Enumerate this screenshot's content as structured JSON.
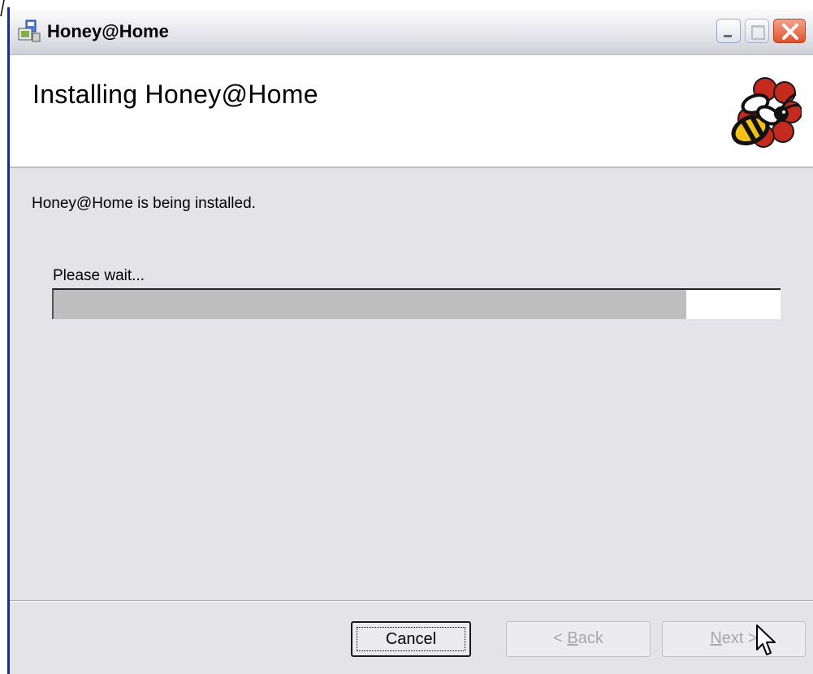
{
  "window": {
    "title": "Honey@Home",
    "controls": {
      "minimize_icon": "minimize-icon",
      "maximize_icon": "maximize-icon",
      "close_icon": "close-icon"
    }
  },
  "banner": {
    "title": "Installing Honey@Home",
    "logo_icon": "bee-logo-icon"
  },
  "body": {
    "status_text": "Honey@Home is being installed.",
    "wait_label": "Please wait..."
  },
  "progress": {
    "fraction": 0.87,
    "fill_color": "#bebebe"
  },
  "buttons": {
    "cancel": "Cancel",
    "back_mnemonic": "B",
    "back_rest": "ack",
    "back_prefix": "< ",
    "next_mnemonic": "N",
    "next_rest": "ext >"
  },
  "colors": {
    "accent": "#0b2fa8",
    "close": "#e2512a",
    "disabled_text": "#a7a7ae"
  }
}
